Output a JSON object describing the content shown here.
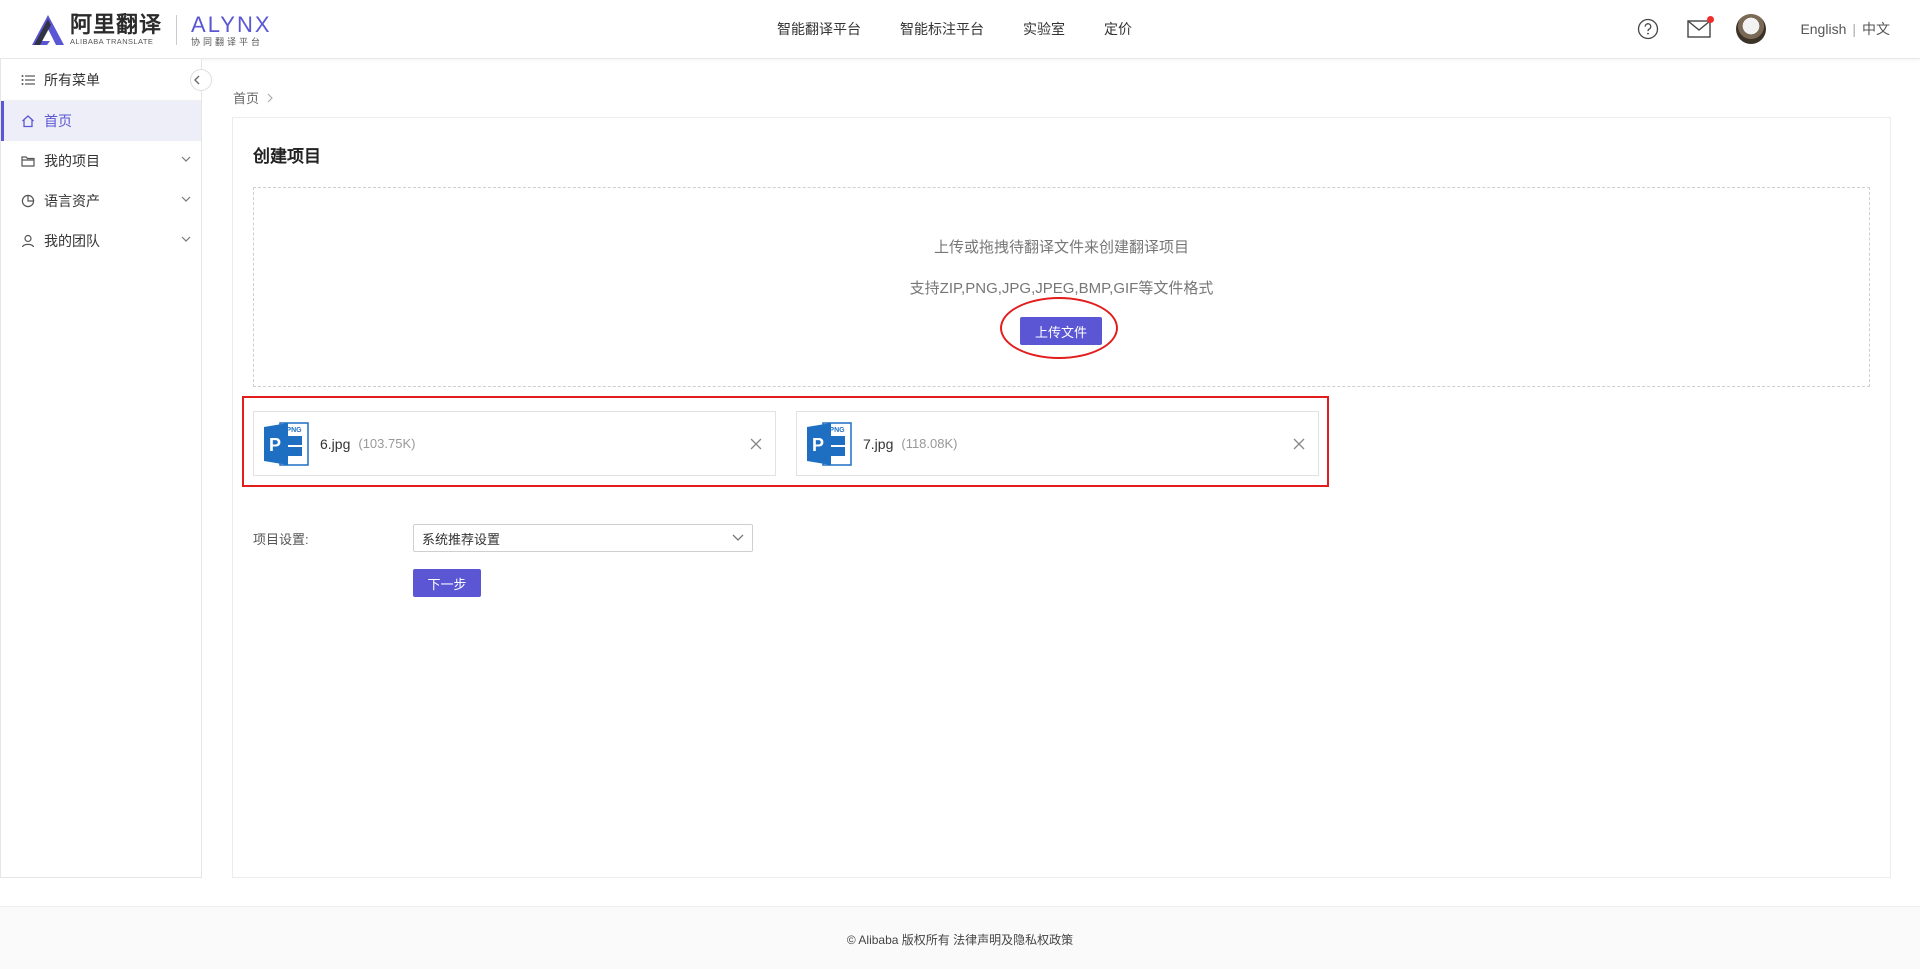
{
  "header": {
    "logo_cn": "阿里翻译",
    "logo_en": "ALIBABA TRANSLATE",
    "logo_alynx": "ALYNX",
    "logo_sub": "协同翻译平台",
    "nav": [
      {
        "label": "智能翻译平台"
      },
      {
        "label": "智能标注平台"
      },
      {
        "label": "实验室"
      },
      {
        "label": "定价"
      }
    ],
    "lang_en": "English",
    "lang_sep": "|",
    "lang_cn": "中文",
    "icons": {
      "help": "help-icon",
      "mail": "mail-icon",
      "avatar": "avatar"
    },
    "notification_dot_color": "#f02d2d"
  },
  "sidebar": {
    "all_menu": "所有菜单",
    "items": [
      {
        "label": "首页",
        "icon": "home-icon",
        "active": true
      },
      {
        "label": "我的项目",
        "icon": "folder-icon"
      },
      {
        "label": "语言资产",
        "icon": "pie-chart-icon"
      },
      {
        "label": "我的团队",
        "icon": "user-icon"
      }
    ]
  },
  "breadcrumb": {
    "home": "首页"
  },
  "main": {
    "title": "创建项目",
    "dropzone": {
      "line1": "上传或拖拽待翻译文件来创建翻译项目",
      "line2": "支持ZIP,PNG,JPG,JPEG,BMP,GIF等文件格式",
      "upload_label": "上传文件"
    },
    "files": [
      {
        "name": "6.jpg",
        "size": "(103.75K)",
        "icon": "png-file-icon"
      },
      {
        "name": "7.jpg",
        "size": "(118.08K)",
        "icon": "png-file-icon"
      }
    ],
    "settings_label": "项目设置:",
    "settings_value": "系统推荐设置",
    "next_label": "下一步"
  },
  "footer": {
    "text": "© Alibaba 版权所有 法律声明及隐私权政策"
  },
  "colors": {
    "accent": "#5a56d4",
    "highlight": "#e31c1c",
    "file_icon_blue": "#1e6fc2"
  }
}
